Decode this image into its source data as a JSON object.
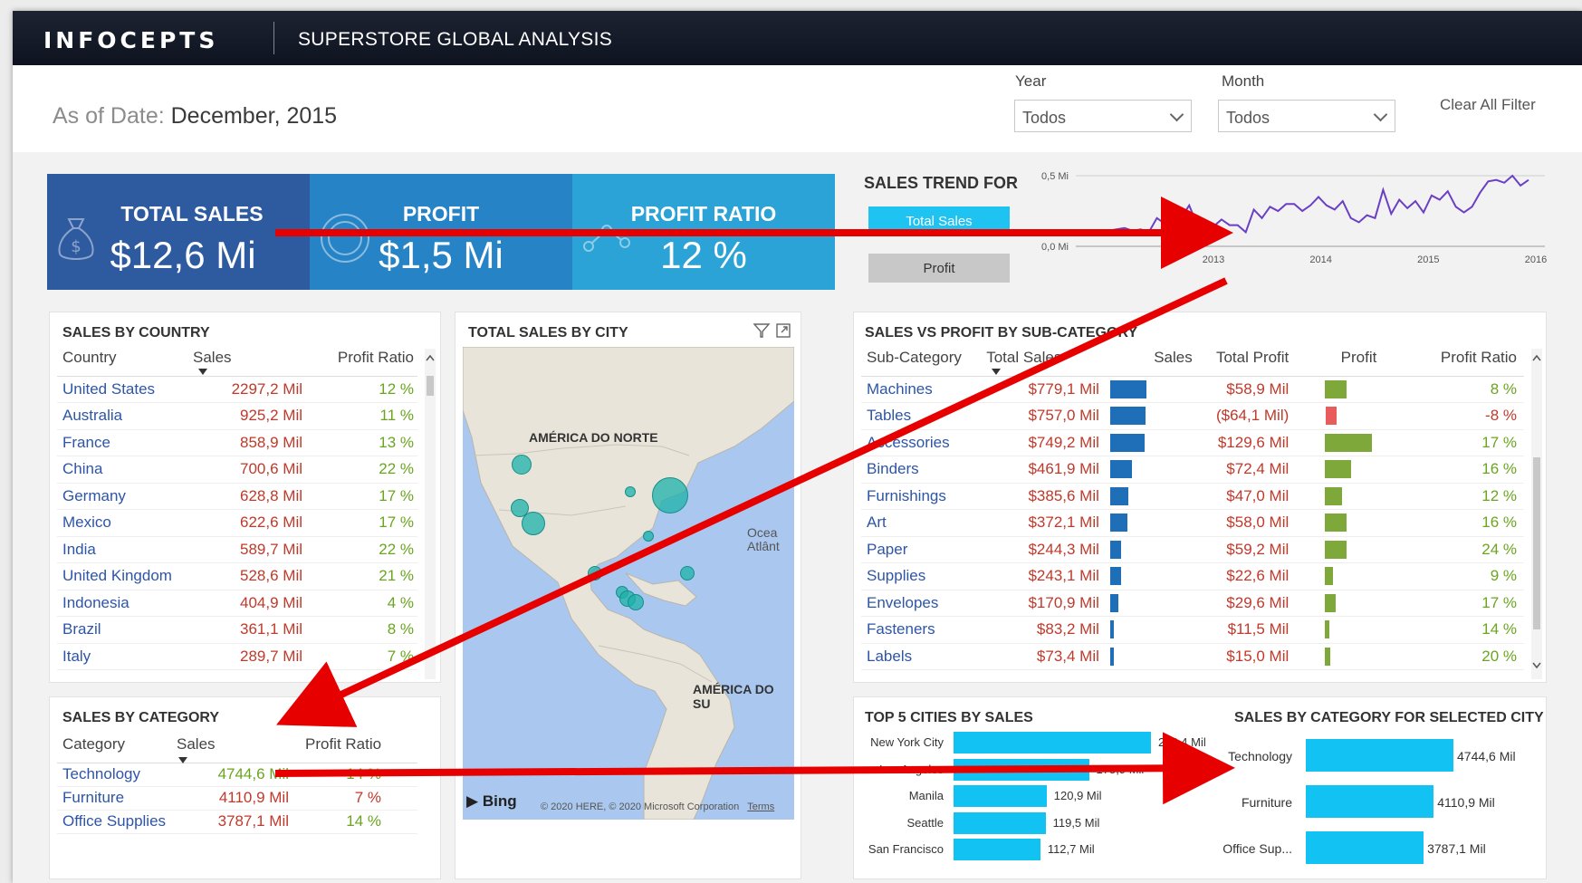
{
  "header": {
    "logo": "INFOCEPTS",
    "title": "SUPERSTORE GLOBAL ANALYSIS"
  },
  "as_of": {
    "label": "As of Date:",
    "value": "December, 2015"
  },
  "filters": {
    "year": {
      "label": "Year",
      "value": "Todos"
    },
    "month": {
      "label": "Month",
      "value": "Todos"
    },
    "clear_label": "Clear All Filter"
  },
  "kpis": {
    "total_sales": {
      "title": "TOTAL SALES",
      "value": "$12,6 Mi",
      "color": "#2e5aa0"
    },
    "profit": {
      "title": "PROFIT",
      "value": "$1,5 Mi",
      "color": "#2583c6"
    },
    "profit_ratio": {
      "title": "PROFIT RATIO",
      "value": "12 %",
      "color": "#2ba3d6"
    }
  },
  "sales_trend": {
    "title": "SALES TREND FOR",
    "btn_sales": "Total Sales",
    "btn_profit": "Profit",
    "y_ticks": [
      "0,5 Mi",
      "0,0 Mi"
    ],
    "x_ticks": [
      "2013",
      "2014",
      "2015",
      "2016"
    ],
    "line_color": "#6a3fc4"
  },
  "chart_data": {
    "type": "line",
    "title": "SALES TREND FOR",
    "xlabel": "",
    "ylabel": "",
    "ylim": [
      0,
      0.5
    ],
    "x_ticks": [
      "2013",
      "2014",
      "2015",
      "2016"
    ],
    "y_unit": "Mi",
    "series": [
      {
        "name": "Total Sales",
        "values": [
          0.11,
          0.12,
          0.13,
          0.11,
          0.12,
          0.1,
          0.2,
          0.16,
          0.27,
          0.2,
          0.29,
          0.15,
          0.14,
          0.14,
          0.19,
          0.15,
          0.15,
          0.1,
          0.26,
          0.2,
          0.28,
          0.25,
          0.3,
          0.3,
          0.25,
          0.29,
          0.35,
          0.29,
          0.26,
          0.32,
          0.2,
          0.17,
          0.22,
          0.2,
          0.4,
          0.23,
          0.33,
          0.27,
          0.32,
          0.24,
          0.36,
          0.33,
          0.39,
          0.28,
          0.24,
          0.28,
          0.38,
          0.46,
          0.47,
          0.45,
          0.5,
          0.43,
          0.47
        ]
      }
    ]
  },
  "sales_by_country": {
    "title": "SALES BY COUNTRY",
    "columns": [
      "Country",
      "Sales",
      "Profit Ratio"
    ],
    "rows": [
      [
        "United States",
        "2297,2 Mil",
        "12 %"
      ],
      [
        "Australia",
        "925,2 Mil",
        "11 %"
      ],
      [
        "France",
        "858,9 Mil",
        "13 %"
      ],
      [
        "China",
        "700,6 Mil",
        "22 %"
      ],
      [
        "Germany",
        "628,8 Mil",
        "17 %"
      ],
      [
        "Mexico",
        "622,6 Mil",
        "17 %"
      ],
      [
        "India",
        "589,7 Mil",
        "22 %"
      ],
      [
        "United Kingdom",
        "528,6 Mil",
        "21 %"
      ],
      [
        "Indonesia",
        "404,9 Mil",
        "4 %"
      ],
      [
        "Brazil",
        "361,1 Mil",
        "8 %"
      ],
      [
        "Italy",
        "289,7 Mil",
        "7 %"
      ]
    ]
  },
  "sales_by_category": {
    "title": "SALES BY CATEGORY",
    "columns": [
      "Category",
      "Sales",
      "Profit Ratio"
    ],
    "rows": [
      [
        "Technology",
        "4744,6 Mil",
        "14 %"
      ],
      [
        "Furniture",
        "4110,9 Mil",
        "7 %"
      ],
      [
        "Office Supplies",
        "3787,1 Mil",
        "14 %"
      ]
    ]
  },
  "map": {
    "title": "TOTAL SALES BY CITY",
    "label_na": "AMÉRICA DO NORTE",
    "label_sa": "AMÉRICA DO SU",
    "label_ocean": "Ocea\nAtlânt",
    "bing": "Bing",
    "copyright": "© 2020 HERE, © 2020 Microsoft Corporation",
    "terms": "Terms"
  },
  "sub_category": {
    "title": "SALES VS PROFIT BY SUB-CATEGORY",
    "columns": [
      "Sub-Category",
      "Total Sales",
      "Sales",
      "Total Profit",
      "Profit",
      "Profit Ratio"
    ],
    "rows": [
      {
        "name": "Machines",
        "sales": "$779,1 Mil",
        "sales_v": 779.1,
        "profit": "$58,9 Mil",
        "profit_v": 58.9,
        "ratio": "8 %"
      },
      {
        "name": "Tables",
        "sales": "$757,0 Mil",
        "sales_v": 757.0,
        "profit": "($64,1 Mil)",
        "profit_v": -64.1,
        "ratio": "-8 %"
      },
      {
        "name": "Accessories",
        "sales": "$749,2 Mil",
        "sales_v": 749.2,
        "profit": "$129,6 Mil",
        "profit_v": 129.6,
        "ratio": "17 %"
      },
      {
        "name": "Binders",
        "sales": "$461,9 Mil",
        "sales_v": 461.9,
        "profit": "$72,4 Mil",
        "profit_v": 72.4,
        "ratio": "16 %"
      },
      {
        "name": "Furnishings",
        "sales": "$385,6 Mil",
        "sales_v": 385.6,
        "profit": "$47,0 Mil",
        "profit_v": 47.0,
        "ratio": "12 %"
      },
      {
        "name": "Art",
        "sales": "$372,1 Mil",
        "sales_v": 372.1,
        "profit": "$58,0 Mil",
        "profit_v": 58.0,
        "ratio": "16 %"
      },
      {
        "name": "Paper",
        "sales": "$244,3 Mil",
        "sales_v": 244.3,
        "profit": "$59,2 Mil",
        "profit_v": 59.2,
        "ratio": "24 %"
      },
      {
        "name": "Supplies",
        "sales": "$243,1 Mil",
        "sales_v": 243.1,
        "profit": "$22,6 Mil",
        "profit_v": 22.6,
        "ratio": "9 %"
      },
      {
        "name": "Envelopes",
        "sales": "$170,9 Mil",
        "sales_v": 170.9,
        "profit": "$29,6 Mil",
        "profit_v": 29.6,
        "ratio": "17 %"
      },
      {
        "name": "Fasteners",
        "sales": "$83,2 Mil",
        "sales_v": 83.2,
        "profit": "$11,5 Mil",
        "profit_v": 11.5,
        "ratio": "14 %"
      },
      {
        "name": "Labels",
        "sales": "$73,4 Mil",
        "sales_v": 73.4,
        "profit": "$15,0 Mil",
        "profit_v": 15.0,
        "ratio": "20 %"
      }
    ]
  },
  "top5": {
    "title": "TOP 5 CITIES BY SALES",
    "bars": [
      {
        "city": "New York City",
        "label": "256,4 Mil",
        "value": 256.4
      },
      {
        "city": "Los Angeles",
        "label": "175,9 Mil",
        "value": 175.9
      },
      {
        "city": "Manila",
        "label": "120,9 Mil",
        "value": 120.9
      },
      {
        "city": "Seattle",
        "label": "119,5 Mil",
        "value": 119.5
      },
      {
        "city": "San Francisco",
        "label": "112,7 Mil",
        "value": 112.7
      }
    ]
  },
  "cat_city": {
    "title": "SALES BY CATEGORY FOR SELECTED CITY",
    "bars": [
      {
        "cat": "Technology",
        "label": "4744,6 Mil",
        "value": 4744.6
      },
      {
        "cat": "Furniture",
        "label": "4110,9 Mil",
        "value": 4110.9
      },
      {
        "cat": "Office Sup...",
        "label": "3787,1 Mil",
        "value": 3787.1
      }
    ]
  },
  "colors": {
    "header": "#141a28",
    "bar_cyan": "#12c2f3",
    "bar_blue": "#1f6fb8",
    "bar_green": "#7ea83a",
    "bar_red": "#e85c5c",
    "arrow": "#e60000"
  }
}
